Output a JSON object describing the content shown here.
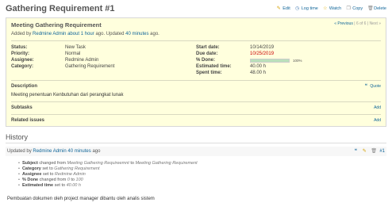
{
  "issue_title": "Gathering Requirement #1",
  "actions": {
    "edit": "Edit",
    "log_time": "Log time",
    "watch": "Watch",
    "copy": "Copy",
    "delete": "Delete"
  },
  "subject": "Meeting Gathering Requirement",
  "author_line": {
    "prefix": "Added by",
    "author": "Redmine Admin",
    "created": "about 1 hour",
    "ago1": "ago. Updated",
    "updated": "40 minutes",
    "ago2": "ago."
  },
  "nav": {
    "previous": "« Previous",
    "separator": "|",
    "position": "6 of 6",
    "next": "Next »"
  },
  "attributes_left": [
    {
      "label": "Status:",
      "value": "New Task"
    },
    {
      "label": "Priority:",
      "value": "Normal"
    },
    {
      "label": "Assignee:",
      "value": "Redmine Admin"
    },
    {
      "label": "Category:",
      "value": "Gathering Requirement"
    }
  ],
  "attributes_right": {
    "start_date": {
      "label": "Start date:",
      "value": "10/14/2019"
    },
    "due_date": {
      "label": "Due date:",
      "value": "10/25/2019"
    },
    "done": {
      "label": "% Done:",
      "value": "100%",
      "fraction": 1.0
    },
    "estimated": {
      "label": "Estimated time:",
      "value": "40.00 h"
    },
    "spent": {
      "label": "Spent time:",
      "value": "48.00 h"
    }
  },
  "description": {
    "heading": "Description",
    "quote": "Quote",
    "text": "Meeting penentuan Kenbutuhan dari perangkat lunak"
  },
  "subtasks": {
    "heading": "Subtasks",
    "add": "Add"
  },
  "related": {
    "heading": "Related issues",
    "add": "Add"
  },
  "history": {
    "heading": "History",
    "journal": {
      "prefix": "Updated by",
      "author": "Redmine Admin",
      "time": "40 minutes",
      "suffix": "ago",
      "number": "#1",
      "changes": [
        {
          "field": "Subject",
          "verb": "changed from",
          "from": "Meeting Gathering Requireemnt",
          "to_word": "to",
          "to": "Meeting Gathering Requirement"
        },
        {
          "field": "Category",
          "verb": "set to",
          "from": "",
          "to_word": "",
          "to": "Gathering Requirement"
        },
        {
          "field": "Assignee",
          "verb": "set to",
          "from": "",
          "to_word": "",
          "to": "Redmine Admin"
        },
        {
          "field": "% Done",
          "verb": "changed from",
          "from": "0",
          "to_word": "to",
          "to": "100"
        },
        {
          "field": "Estimated time",
          "verb": "set to",
          "from": "",
          "to_word": "",
          "to": "40.00 h"
        }
      ],
      "notes": "Pembuatan dokumen oleh project manager dibantu oleh analis sistem"
    }
  },
  "colors": {
    "issue_bg": "#ffffdd",
    "link": "#116699",
    "due_date": "#cc0000",
    "progress_fill": "#bae0ba"
  }
}
